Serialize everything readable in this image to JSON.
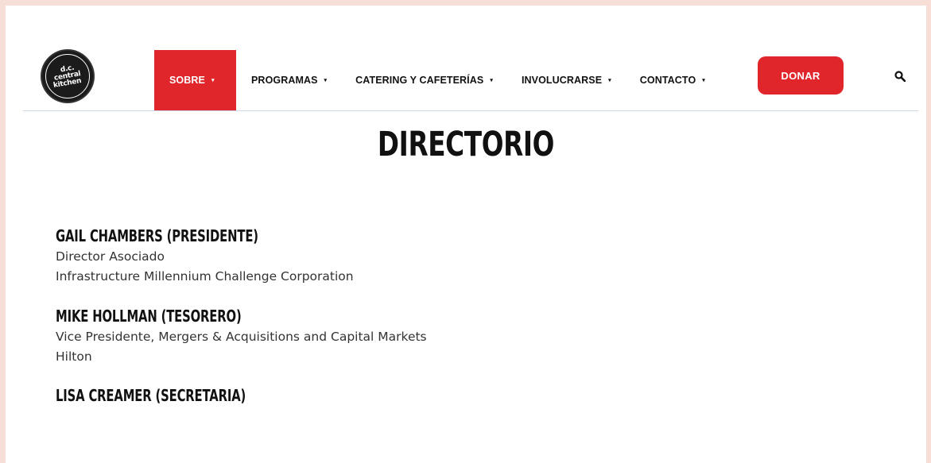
{
  "logo": {
    "line1": "d.c.",
    "line2": "central",
    "line3": "kitchen"
  },
  "nav": {
    "items": [
      {
        "label": "SOBRE",
        "caret": "▾"
      },
      {
        "label": "PROGRAMAS",
        "caret": "▾"
      },
      {
        "label": "CATERING Y CAFETERÍAS",
        "caret": "▾"
      },
      {
        "label": "INVOLUCRARSE",
        "caret": "▾"
      },
      {
        "label": "CONTACTO",
        "caret": "▾"
      }
    ],
    "donate_label": "DONAR",
    "search_icon": "search-icon"
  },
  "colors": {
    "accent": "#e0262a",
    "background_border": "#f7dfd8"
  },
  "page": {
    "title": "DIRECTORIO"
  },
  "directory": [
    {
      "name": "GAIL CHAMBERS (PRESIDENTE)",
      "lines": [
        "Director Asociado",
        "Infrastructure Millennium Challenge Corporation"
      ]
    },
    {
      "name": "MIKE HOLLMAN (TESORERO)",
      "lines": [
        "Vice Presidente, Mergers & Acquisitions and Capital Markets",
        "Hilton"
      ]
    },
    {
      "name": "LISA CREAMER (SECRETARIA)",
      "lines": []
    }
  ]
}
